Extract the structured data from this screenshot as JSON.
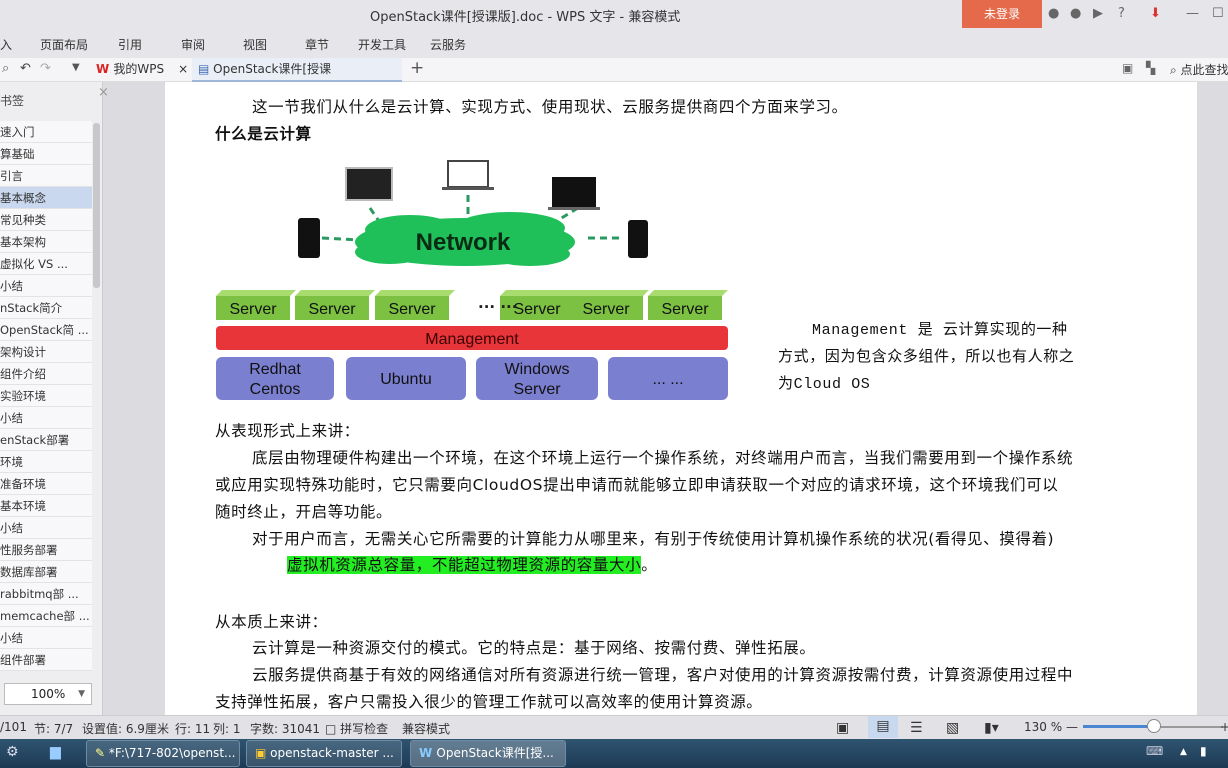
{
  "titlebar": {
    "title": "OpenStack课件[授课版].doc - WPS 文字 - 兼容模式",
    "login": "未登录",
    "icons": [
      "skin-icon",
      "settings-icon",
      "share-icon",
      "help-icon",
      "download-icon",
      "minimize-icon",
      "maximize-icon"
    ],
    "help": "?"
  },
  "menu": [
    "入",
    "页面布局",
    "引用",
    "审阅",
    "视图",
    "章节",
    "开发工具",
    "云服务"
  ],
  "tabs": {
    "home": "我的WPS",
    "doc": "OpenStack课件[授课版].doc",
    "close": "×",
    "add": "+",
    "search": "点此查找"
  },
  "sidebar": {
    "title": "书签",
    "items": [
      "速入门",
      "算基础",
      "引言",
      "基本概念",
      "常见种类",
      "基本架构",
      "虚拟化 VS ...",
      "小结",
      "nStack简介",
      "OpenStack简 ...",
      "架构设计",
      "组件介绍",
      "实验环境",
      "小结",
      "enStack部署",
      "环境",
      "准备环境",
      "基本环境",
      "小结",
      "性服务部署",
      "数据库部署",
      "rabbitmq部 ...",
      "memcache部 ...",
      "小结",
      "组件部署"
    ],
    "selected_index": 3,
    "zoom": "100%"
  },
  "doc": {
    "p1": "这一节我们从什么是云计算、实现方式、使用现状、云服务提供商四个方面来学习。",
    "h1": "什么是云计算",
    "diagram": {
      "network": "Network",
      "servers": [
        "Server",
        "Server",
        "Server",
        "Server",
        "Server",
        "Server"
      ],
      "dots": "··· ···",
      "management": "Management",
      "os": [
        "Redhat",
        "Centos",
        "Ubuntu",
        "Windows",
        "Server",
        "... ..."
      ]
    },
    "side1": "Management 是 云计算实现的一种",
    "side2": "方式，因为包含众多组件，所以也有人称之",
    "side3": "为Cloud OS",
    "p2": "从表现形式上来讲：",
    "p3a": "底层由物理硬件构建出一个环境，在这个环境上运行一个操作系统，对终端用户而言，当我们需要用到一个操作系统",
    "p3b": "或应用实现特殊功能时，它只需要向CloudOS提出申请而就能够立即申请获取一个对应的请求环境，这个环境我们可以",
    "p3c": "随时终止，开启等功能。",
    "p4": "对于用户而言，无需关心它所需要的计算能力从哪里来，有别于传统使用计算机操作系统的状况(看得见、摸得着)",
    "p5": "虚拟机资源总容量，不能超过物理资源的容量大小",
    "p5end": "。",
    "p6": "从本质上来讲：",
    "p7": "云计算是一种资源交付的模式。它的特点是：基于网络、按需付费、弹性拓展。",
    "p8a": "云服务提供商基于有效的网络通信对所有资源进行统一管理，客户对使用的计算资源按需付费，计算资源使用过程中",
    "p8b": "支持弹性拓展，客户只需投入很少的管理工作就可以高效率的使用计算资源。"
  },
  "status": {
    "page": "/101",
    "section": "节: 7/7",
    "setting": "设置值: 6.9厘米",
    "row": "行: 11",
    "col": "列: 1",
    "words": "字数: 31041",
    "spell": "□ 拼写检查",
    "mode": "兼容模式",
    "zoom": "130 %",
    "zoom_percent": 130
  },
  "taskbar": {
    "items": [
      "*F:\\717-802\\openst...",
      "openstack-master ...",
      "OpenStack课件[授..."
    ]
  },
  "colors": {
    "login": "#e46a4b",
    "highlight": "#22ee22",
    "server": "#7cc142",
    "management": "#e8353a",
    "os": "#7b7fd0",
    "network": "#1fbf5a"
  }
}
